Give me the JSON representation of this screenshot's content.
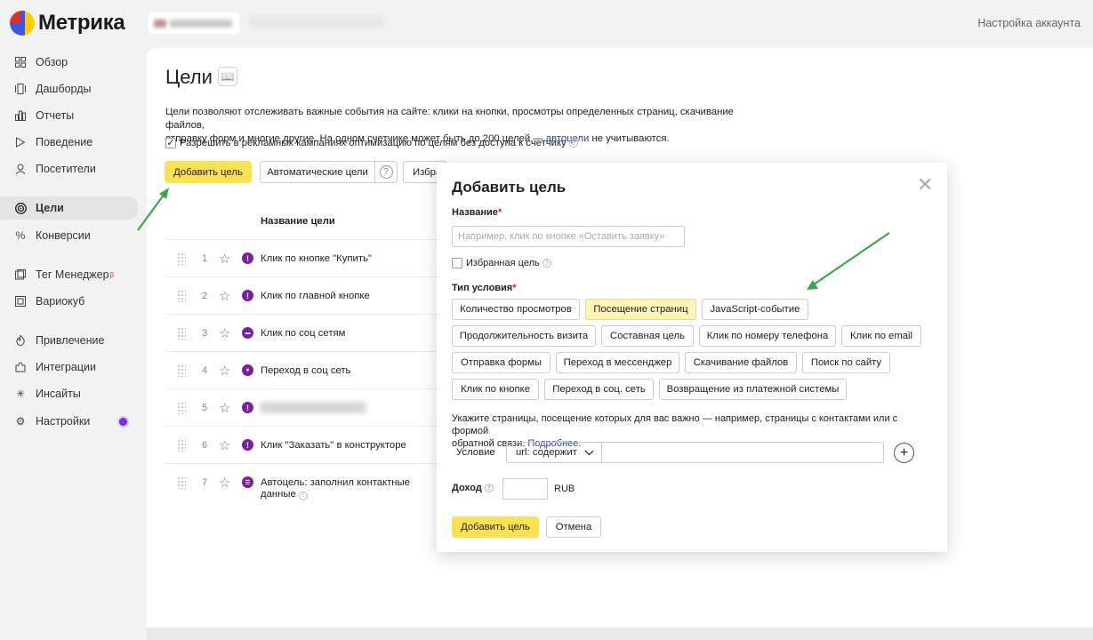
{
  "header": {
    "logo_text": "Метрика",
    "account_link": "Настройка аккаунта"
  },
  "sidebar": {
    "items": [
      {
        "label": "Обзор",
        "icon": "grid-icon"
      },
      {
        "label": "Дашборды",
        "icon": "dashboards-icon"
      },
      {
        "label": "Отчеты",
        "icon": "bar-chart-icon"
      },
      {
        "label": "Поведение",
        "icon": "play-icon"
      },
      {
        "label": "Посетители",
        "icon": "user-icon"
      },
      {
        "label": "Цели",
        "icon": "target-icon"
      },
      {
        "label": "Конверсии",
        "icon": "percent-icon"
      },
      {
        "label": "Тег Менеджер",
        "icon": "tag-icon",
        "badge": "β"
      },
      {
        "label": "Вариокуб",
        "icon": "cube-icon"
      },
      {
        "label": "Привлечение",
        "icon": "flame-icon"
      },
      {
        "label": "Интеграции",
        "icon": "puzzle-icon"
      },
      {
        "label": "Инсайты",
        "icon": "sparkle-icon"
      },
      {
        "label": "Настройки",
        "icon": "gear-icon"
      }
    ]
  },
  "page": {
    "title": "Цели",
    "description_1": "Цели позволяют отслеживать важные события на сайте: клики на кнопки, просмотры определенных страниц, скачивание файлов,",
    "description_2": "отправку форм и многие другие. На одном счетчике может быть до 200 целей — ",
    "autogoals_link": "автоцели",
    "description_3": " не учитываются.",
    "allow_checkbox_label": "Разрешить в рекламных кампаниях оптимизацию по целям без доступа к счетчику",
    "add_goal_button": "Добавить цель",
    "auto_goals_button": "Автоматические цели",
    "favorites_button_partial": "Избра",
    "column_header": "Название цели"
  },
  "goals": [
    {
      "num": "1",
      "name": "Клик по кнопке \"Купить\"",
      "icon_glyph": "!"
    },
    {
      "num": "2",
      "name": "Клик по главной кнопке",
      "icon_glyph": "!"
    },
    {
      "num": "3",
      "name": "Клик по соц сетям",
      "icon_glyph": "▬"
    },
    {
      "num": "4",
      "name": "Переход в соц сеть",
      "icon_glyph": "●"
    },
    {
      "num": "5",
      "name": "",
      "icon_glyph": "!"
    },
    {
      "num": "6",
      "name": "Клик \"Заказать\" в конструкторе",
      "icon_glyph": "!"
    },
    {
      "num": "7",
      "name": "Автоцель: заполнил контактные",
      "name_line2": "данные",
      "icon_glyph": "☰"
    }
  ],
  "modal": {
    "title": "Добавить цель",
    "name_label": "Название",
    "name_placeholder": "Например, клик по кнопке «Оставить заявку»",
    "favorite_label": "Избранная цель",
    "condition_type_label": "Тип условия",
    "condition_types": [
      "Количество просмотров",
      "Посещение страниц",
      "JavaScript-событие",
      "Продолжительность визита",
      "Составная цель",
      "Клик по номеру телефона",
      "Клик по email",
      "Отправка формы",
      "Переход в мессенджер",
      "Скачивание файлов",
      "Поиск по сайту",
      "Клик по кнопке",
      "Переход в соц. сеть",
      "Возвращение из платежной системы"
    ],
    "selected_type": "Посещение страниц",
    "hint_1": "Укажите страницы, посещение которых для вас важно — например, страницы с контактами или с формой",
    "hint_2": "обратной связи. ",
    "more_link": "Подробнее",
    "condition_label": "Условие",
    "condition_select": "url: содержит",
    "income_label": "Доход",
    "currency": "RUB",
    "submit_button": "Добавить цель",
    "cancel_button": "Отмена"
  },
  "colors": {
    "accent_yellow": "#fce252",
    "selected_type_bg": "#fef3b8",
    "goal_icon_purple": "#7b1fa2",
    "arrow_green": "#3aa84a",
    "link_blue": "#2a3fb0"
  }
}
